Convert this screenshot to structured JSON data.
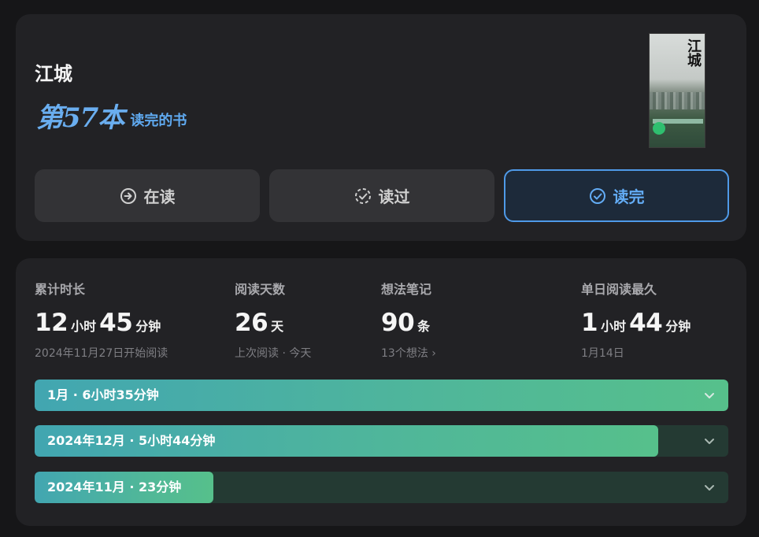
{
  "book": {
    "title": "江城",
    "cover_title": "江城",
    "finished_count": "第57本",
    "finished_label": "读完的书"
  },
  "status_buttons": [
    {
      "label": "在读",
      "icon": "arrow-circle-icon",
      "selected": false
    },
    {
      "label": "读过",
      "icon": "dashed-check-circle-icon",
      "selected": false
    },
    {
      "label": "读完",
      "icon": "check-circle-icon",
      "selected": true
    }
  ],
  "stats": {
    "total_time": {
      "label": "累计时长",
      "hours": "12",
      "hours_unit": "小时",
      "minutes": "45",
      "minutes_unit": "分钟",
      "sub": "2024年11月27日开始阅读"
    },
    "days": {
      "label": "阅读天数",
      "value": "26",
      "unit": "天",
      "sub": "上次阅读 · 今天"
    },
    "notes": {
      "label": "想法笔记",
      "value": "90",
      "unit": "条",
      "sub": "13个想法 ›"
    },
    "longest": {
      "label": "单日阅读最久",
      "hours": "1",
      "hours_unit": "小时",
      "minutes": "44",
      "minutes_unit": "分钟",
      "sub": "1月14日"
    }
  },
  "months": [
    {
      "label": "1月 · 6小时35分钟",
      "fraction": 1.0
    },
    {
      "label": "2024年12月 · 5小时44分钟",
      "fraction": 0.899
    },
    {
      "label": "2024年11月 · 23分钟",
      "fraction": 0.258
    }
  ],
  "colors": {
    "accent": "#4f9ae8",
    "bar_fill_start": "#42a6b1",
    "bar_fill_end": "#56c08b",
    "bar_track": "#243a33"
  }
}
